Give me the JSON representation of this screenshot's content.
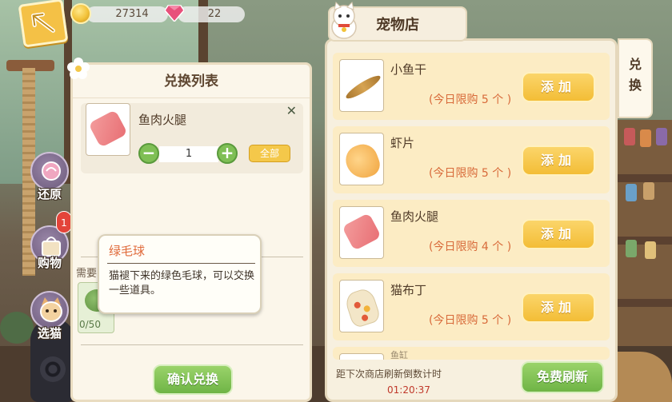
{
  "resources": {
    "coins": "27314",
    "gems": "22"
  },
  "side_nav": [
    {
      "label": "还原"
    },
    {
      "label": "购物",
      "badge": "1"
    },
    {
      "label": "选猫"
    }
  ],
  "exchange_panel": {
    "title": "兑换列表",
    "item": {
      "name": "鱼肉火腿",
      "quantity": "1",
      "all_label": "全部"
    },
    "need_label": "需要",
    "need_count": "0/50",
    "confirm_label": "确认兑换"
  },
  "tooltip": {
    "title": "绿毛球",
    "description": "猫褪下来的绿色毛球，可以交换一些道具。"
  },
  "shop": {
    "title": "宠物店",
    "items": [
      {
        "name": "小鱼干",
        "limit": "(今日限购 5 个 )",
        "add_label": "添加"
      },
      {
        "name": "虾片",
        "limit": "(今日限购 5 个 )",
        "add_label": "添加"
      },
      {
        "name": "鱼肉火腿",
        "limit": "(今日限购 4 个 )",
        "add_label": "添加"
      },
      {
        "name": "猫布丁",
        "limit": "(今日限购 5 个 )",
        "add_label": "添加"
      }
    ],
    "next_item_partial": "鱼缸",
    "refresh_countdown_label": "距下次商店刷新倒数计时",
    "refresh_countdown": "01:20:37",
    "free_refresh_label": "免费刷新"
  },
  "side_tab": {
    "label": "兑换"
  }
}
